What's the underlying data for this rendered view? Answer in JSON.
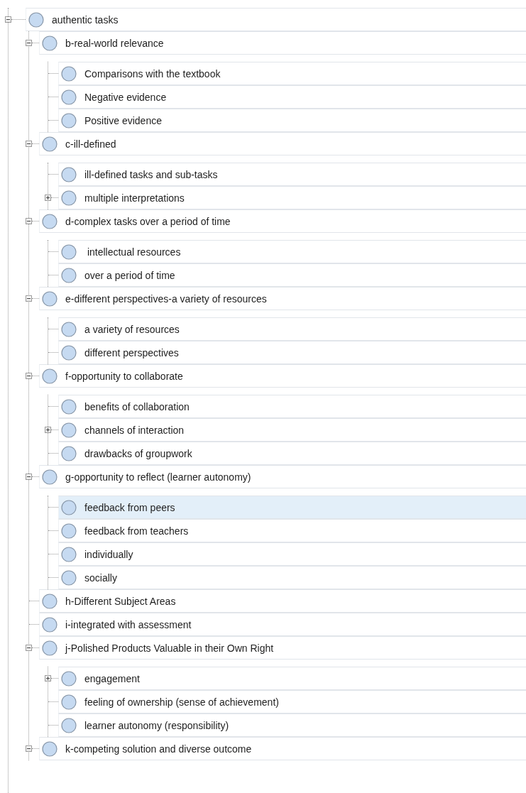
{
  "tree": {
    "label": "authentic tasks",
    "expanded": true,
    "selected": false,
    "children": [
      {
        "label": "b-real-world relevance",
        "expanded": true,
        "selected": false,
        "children": [
          {
            "label": "Comparisons with the textbook",
            "selected": false
          },
          {
            "label": "Negative evidence",
            "selected": false
          },
          {
            "label": "Positive evidence",
            "selected": false
          }
        ]
      },
      {
        "label": "c-ill-defined",
        "expanded": true,
        "selected": false,
        "children": [
          {
            "label": "ill-defined tasks and sub-tasks",
            "selected": false
          },
          {
            "label": "multiple interpretations",
            "expanded": false,
            "selected": false
          }
        ]
      },
      {
        "label": "d-complex tasks over a period of time",
        "expanded": true,
        "selected": false,
        "children": [
          {
            "label": " intellectual resources",
            "selected": false
          },
          {
            "label": "over a period of time",
            "selected": false
          }
        ]
      },
      {
        "label": "e-different perspectives-a variety of resources",
        "expanded": true,
        "selected": false,
        "children": [
          {
            "label": "a variety of resources",
            "selected": false
          },
          {
            "label": "different perspectives",
            "selected": false
          }
        ]
      },
      {
        "label": "f-opportunity to collaborate",
        "expanded": true,
        "selected": false,
        "children": [
          {
            "label": "benefits of collaboration",
            "selected": false
          },
          {
            "label": "channels of interaction",
            "expanded": false,
            "selected": false
          },
          {
            "label": "drawbacks of groupwork",
            "selected": false
          }
        ]
      },
      {
        "label": "g-opportunity to reflect (learner autonomy)",
        "expanded": true,
        "selected": false,
        "children": [
          {
            "label": "feedback from peers",
            "selected": true
          },
          {
            "label": "feedback from teachers",
            "selected": false
          },
          {
            "label": "individually",
            "selected": false
          },
          {
            "label": "socially",
            "selected": false
          }
        ]
      },
      {
        "label": "h-Different Subject Areas",
        "selected": false
      },
      {
        "label": "i-integrated with assessment",
        "selected": false
      },
      {
        "label": "j-Polished Products Valuable in their Own Right",
        "expanded": true,
        "selected": false,
        "children": [
          {
            "label": "engagement",
            "expanded": false,
            "selected": false
          },
          {
            "label": "feeling of ownership (sense of achievement)",
            "selected": false
          },
          {
            "label": "learner autonomy (responsibility)",
            "selected": false
          }
        ]
      },
      {
        "label": "k-competing solution and diverse outcome",
        "expanded": true,
        "selected": false
      }
    ]
  }
}
